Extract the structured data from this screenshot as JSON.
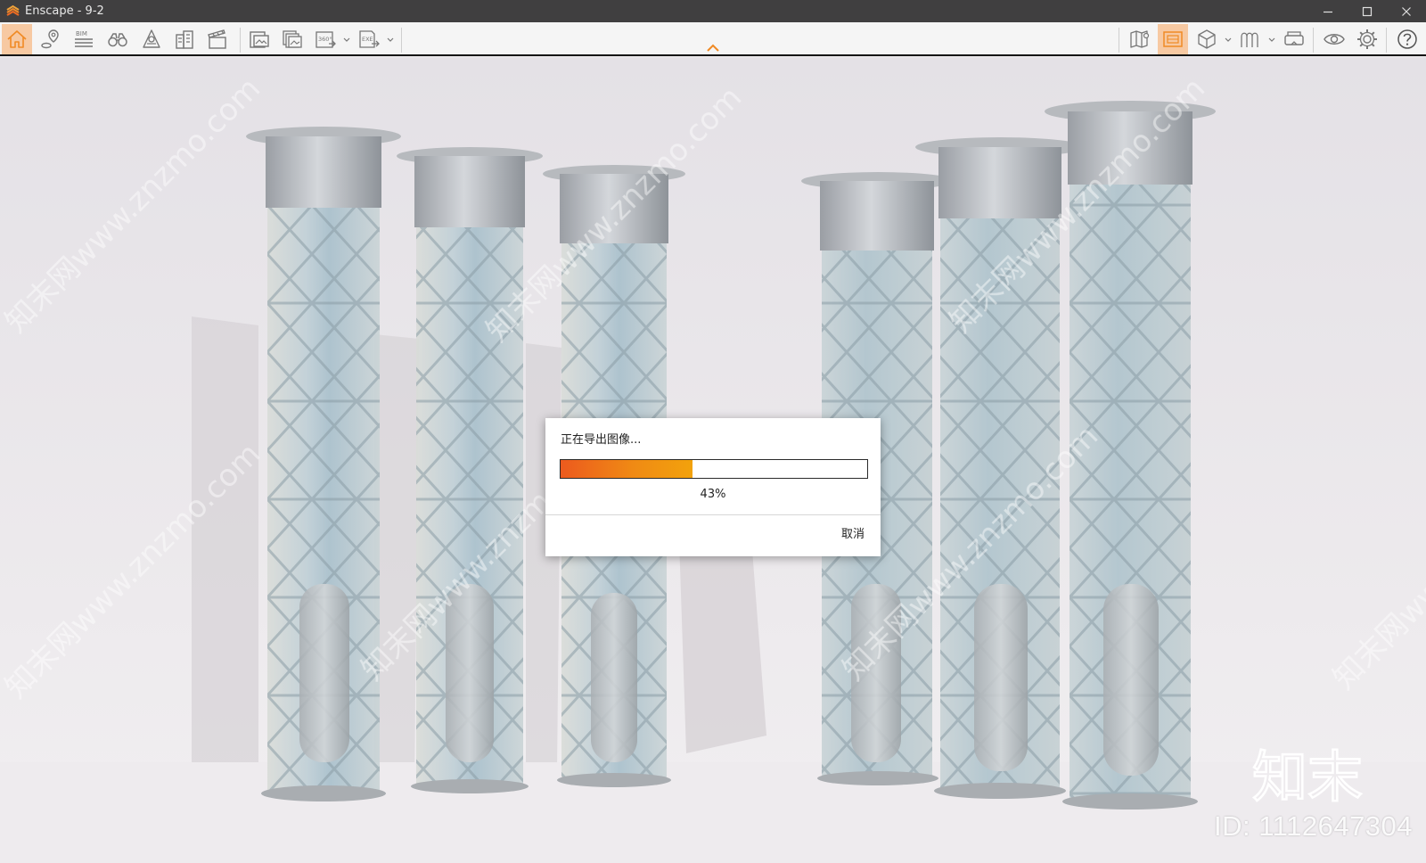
{
  "window": {
    "title": "Enscape - 9-2",
    "controls": [
      "minimize-icon",
      "maximize-icon",
      "close-icon"
    ]
  },
  "toolbar": {
    "left": [
      {
        "id": "home",
        "icon": "home-icon",
        "active": true
      },
      {
        "id": "location",
        "icon": "location-pin-icon"
      },
      {
        "id": "bim",
        "icon": "bim-icon",
        "text": "BIM"
      },
      {
        "id": "views",
        "icon": "binoculars-icon"
      },
      {
        "id": "atmosphere",
        "icon": "atmosphere-icon"
      },
      {
        "id": "assets",
        "icon": "buildings-icon"
      },
      {
        "id": "video",
        "icon": "clapperboard-icon"
      },
      {
        "id": "render-image",
        "icon": "render-image-icon"
      },
      {
        "id": "batch-render",
        "icon": "batch-render-icon"
      },
      {
        "id": "panorama",
        "icon": "panorama-360-icon",
        "text": "360°",
        "dropdown": true
      },
      {
        "id": "export-exe",
        "icon": "export-exe-icon",
        "text": "EXE",
        "dropdown": true
      }
    ],
    "right": [
      {
        "id": "map",
        "icon": "map-icon"
      },
      {
        "id": "capture",
        "icon": "capture-icon",
        "active": true
      },
      {
        "id": "cube",
        "icon": "cube-icon",
        "dropdown": true
      },
      {
        "id": "materials",
        "icon": "material-icon",
        "dropdown": true
      },
      {
        "id": "vr",
        "icon": "vr-headset-icon"
      },
      {
        "id": "visual-settings",
        "icon": "eye-icon"
      },
      {
        "id": "settings",
        "icon": "gear-icon"
      },
      {
        "id": "help",
        "icon": "help-icon"
      }
    ],
    "accent_color": "#f08a24",
    "active_bg": "#f7c9a2"
  },
  "dialog": {
    "title": "正在导出图像...",
    "progress": 0.43,
    "progress_text": "43%",
    "cancel_label": "取消"
  },
  "watermark": {
    "logo_text": "知末",
    "id_text": "ID: 1112647304",
    "diagonal_text": "知末网www.znzmo.com"
  }
}
